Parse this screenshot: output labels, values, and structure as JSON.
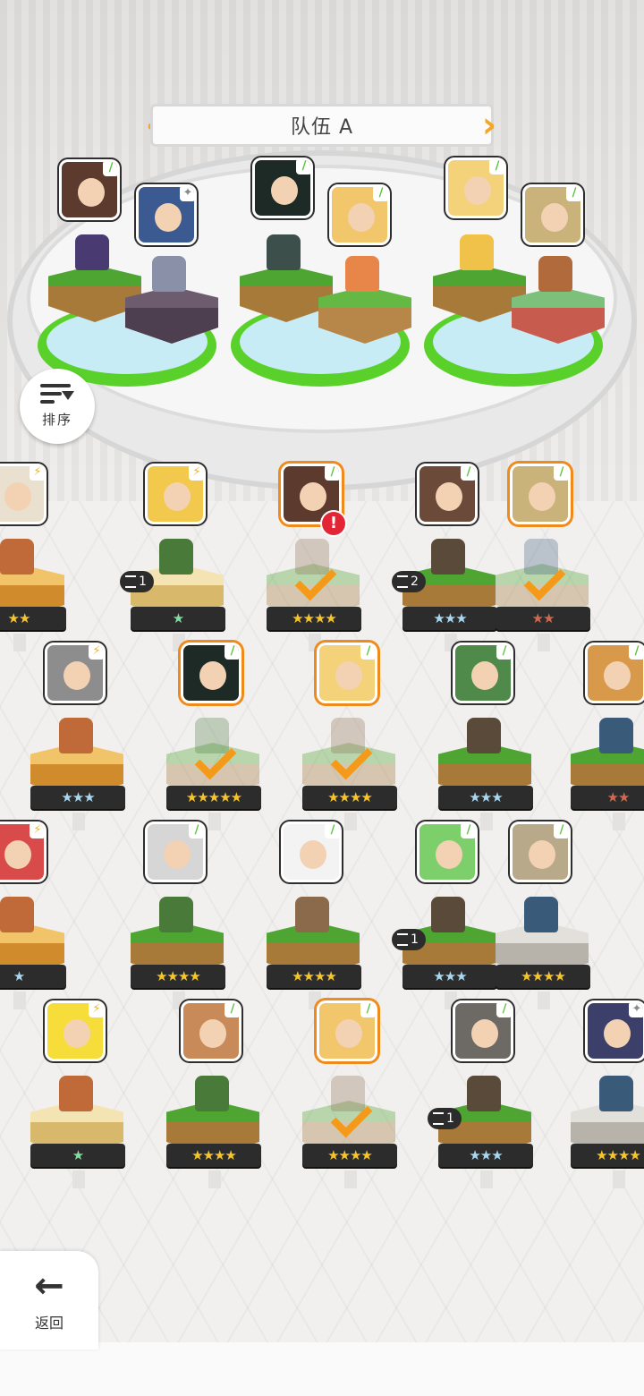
{
  "header": {
    "team_name": "队伍 A"
  },
  "buttons": {
    "sort_label": "排序",
    "back_label": "返回"
  },
  "roster": [
    {
      "row": 1,
      "items": [
        {
          "stars": "★★",
          "tier": "gold",
          "selected": false
        },
        {
          "stars": "★",
          "tier": "green",
          "copies": "1",
          "selected": false
        },
        {
          "stars": "★★★★",
          "tier": "gold",
          "selected": true,
          "alert": "!"
        },
        {
          "stars": "★★★",
          "tier": "silver",
          "copies": "2",
          "selected": false
        },
        {
          "stars": "★★",
          "tier": "bronze",
          "selected": true
        }
      ]
    },
    {
      "row": 2,
      "items": [
        {
          "stars": "★★★",
          "tier": "silver",
          "selected": false
        },
        {
          "stars": "★★★★★",
          "tier": "gold",
          "selected": true
        },
        {
          "stars": "★★★★",
          "tier": "gold",
          "selected": true
        },
        {
          "stars": "★★★",
          "tier": "silver",
          "selected": false
        },
        {
          "stars": "★★",
          "tier": "bronze",
          "selected": false
        }
      ]
    },
    {
      "row": 3,
      "items": [
        {
          "stars": "★",
          "tier": "silver",
          "selected": false
        },
        {
          "stars": "★★★★",
          "tier": "gold",
          "selected": false
        },
        {
          "stars": "★★★★",
          "tier": "gold",
          "selected": false
        },
        {
          "stars": "★★★",
          "tier": "silver",
          "copies": "1",
          "selected": false
        },
        {
          "stars": "★★★★",
          "tier": "gold",
          "selected": false
        }
      ]
    },
    {
      "row": 4,
      "items": [
        {
          "stars": "★",
          "tier": "green",
          "selected": false
        },
        {
          "stars": "★★★★",
          "tier": "gold",
          "selected": false
        },
        {
          "stars": "★★★★",
          "tier": "gold",
          "selected": true
        },
        {
          "stars": "★★★",
          "tier": "silver",
          "copies": "1",
          "selected": false
        },
        {
          "stars": "★★★★",
          "tier": "gold",
          "selected": false
        }
      ]
    }
  ],
  "colors": {
    "accent": "#f5a623",
    "selected_outline": "#f08a1a",
    "alert": "#e32636",
    "pad": "#5ad12a"
  }
}
